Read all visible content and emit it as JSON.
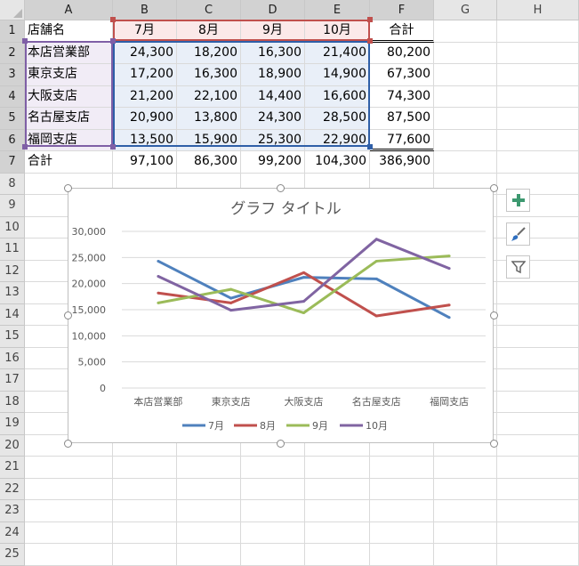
{
  "sheet": {
    "columns": [
      "A",
      "B",
      "C",
      "D",
      "E",
      "F",
      "G",
      "H"
    ],
    "rows": [
      "1",
      "2",
      "3",
      "4",
      "5",
      "6",
      "7",
      "8",
      "9",
      "10",
      "11",
      "12",
      "13",
      "14",
      "15",
      "16",
      "17",
      "18",
      "19",
      "20",
      "21",
      "22",
      "23",
      "24",
      "25"
    ],
    "table": {
      "header": [
        "店舗名",
        "7月",
        "8月",
        "9月",
        "10月",
        "合計"
      ],
      "body": [
        [
          "本店営業部",
          "24,300",
          "18,200",
          "16,300",
          "21,400",
          "80,200"
        ],
        [
          "東京支店",
          "17,200",
          "16,300",
          "18,900",
          "14,900",
          "67,300"
        ],
        [
          "大阪支店",
          "21,200",
          "22,100",
          "14,400",
          "16,600",
          "74,300"
        ],
        [
          "名古屋支店",
          "20,900",
          "13,800",
          "24,300",
          "28,500",
          "87,500"
        ],
        [
          "福岡支店",
          "13,500",
          "15,900",
          "25,300",
          "22,900",
          "77,600"
        ]
      ],
      "total": [
        "合計",
        "97,100",
        "86,300",
        "99,200",
        "104,300",
        "386,900"
      ]
    }
  },
  "chart_data": {
    "type": "line",
    "title": "グラフ タイトル",
    "categories": [
      "本店営業部",
      "東京支店",
      "大阪支店",
      "名古屋支店",
      "福岡支店"
    ],
    "series": [
      {
        "name": "7月",
        "color": "#4f81bd",
        "values": [
          24300,
          17200,
          21200,
          20900,
          13500
        ]
      },
      {
        "name": "8月",
        "color": "#c0504d",
        "values": [
          18200,
          16300,
          22100,
          13800,
          15900
        ]
      },
      {
        "name": "9月",
        "color": "#9bbb59",
        "values": [
          16300,
          18900,
          14400,
          24300,
          25300
        ]
      },
      {
        "name": "10月",
        "color": "#8064a2",
        "values": [
          21400,
          14900,
          16600,
          28500,
          22900
        ]
      }
    ],
    "ylim": [
      0,
      30000
    ],
    "yticks": [
      0,
      5000,
      10000,
      15000,
      20000,
      25000,
      30000
    ],
    "ytick_labels": [
      "0",
      "5,000",
      "10,000",
      "15,000",
      "20,000",
      "25,000",
      "30,000"
    ],
    "grid": true,
    "legend": "bottom"
  },
  "side_buttons": {
    "elements": "plus-icon",
    "styles": "brush-icon",
    "filter": "filter-icon"
  },
  "colors": {
    "purple": "#7f5fa6",
    "red": "#c0504d",
    "blue": "#2f5fa8",
    "accent_green": "#3d9970"
  }
}
